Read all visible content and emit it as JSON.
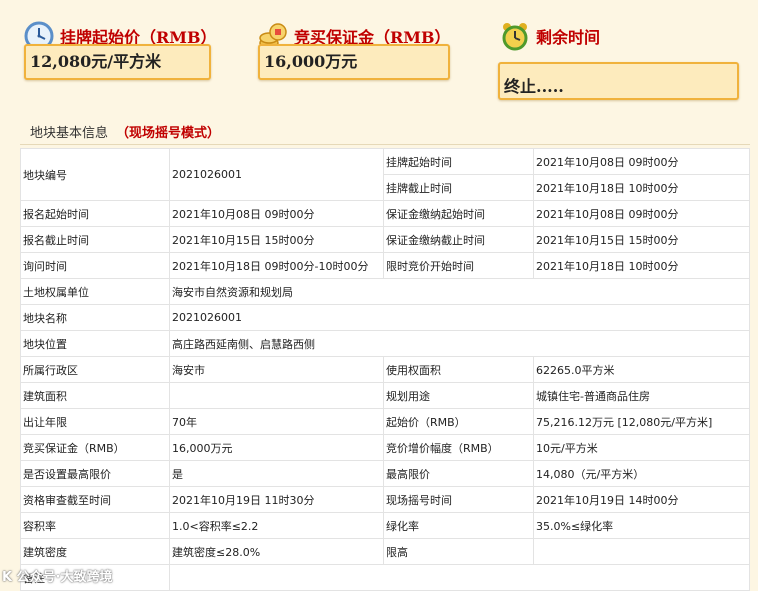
{
  "cards": [
    {
      "title": "挂牌起始价（RMB）",
      "value": "12,080元/平方米"
    },
    {
      "title": "竞买保证金（RMB）",
      "value": "16,000万元"
    },
    {
      "title": "剩余时间",
      "value": "终止....."
    }
  ],
  "section": {
    "title": "地块基本信息",
    "mode": "（现场摇号模式）"
  },
  "table": {
    "parcel_no_label": "地块编号",
    "parcel_no": "2021026001",
    "list_start_label": "挂牌起始时间",
    "list_start": "2021年10月08日 09时00分",
    "list_end_label": "挂牌截止时间",
    "list_end": "2021年10月18日 10时00分",
    "rows": [
      [
        "报名起始时间",
        "2021年10月08日 09时00分",
        "保证金缴纳起始时间",
        "2021年10月08日 09时00分"
      ],
      [
        "报名截止时间",
        "2021年10月15日 15时00分",
        "保证金缴纳截止时间",
        "2021年10月15日 15时00分"
      ],
      [
        "询问时间",
        "2021年10月18日 09时00分-10时00分",
        "限时竞价开始时间",
        "2021年10月18日 10时00分"
      ]
    ],
    "wide_rows": [
      [
        "土地权属单位",
        "海安市自然资源和规划局"
      ],
      [
        "地块名称",
        "2021026001"
      ],
      [
        "地块位置",
        "高庄路西延南侧、启慧路西侧"
      ]
    ],
    "rows2": [
      [
        "所属行政区",
        "海安市",
        "使用权面积",
        "62265.0平方米"
      ],
      [
        "建筑面积",
        "",
        "规划用途",
        "城镇住宅-普通商品住房"
      ],
      [
        "出让年限",
        "70年",
        "起始价（RMB）",
        "75,216.12万元 [12,080元/平方米]"
      ],
      [
        "竞买保证金（RMB）",
        "16,000万元",
        "竞价增价幅度（RMB）",
        "10元/平方米"
      ],
      [
        "是否设置最高限价",
        "是",
        "最高限价",
        "14,080（元/平方米）"
      ],
      [
        "资格审查截至时间",
        "2021年10月19日 11时30分",
        "现场摇号时间",
        "2021年10月19日 14时00分"
      ],
      [
        "容积率",
        "1.0<容积率≤2.2",
        "绿化率",
        "35.0%≤绿化率"
      ],
      [
        "建筑密度",
        "建筑密度≤28.0%",
        "限高",
        ""
      ]
    ],
    "remark_label": "备注"
  },
  "watermark": "K 公众号·大致跨境",
  "icons": {
    "price": "clock-icon",
    "deposit": "coins-icon",
    "time": "alarm-clock-icon"
  }
}
